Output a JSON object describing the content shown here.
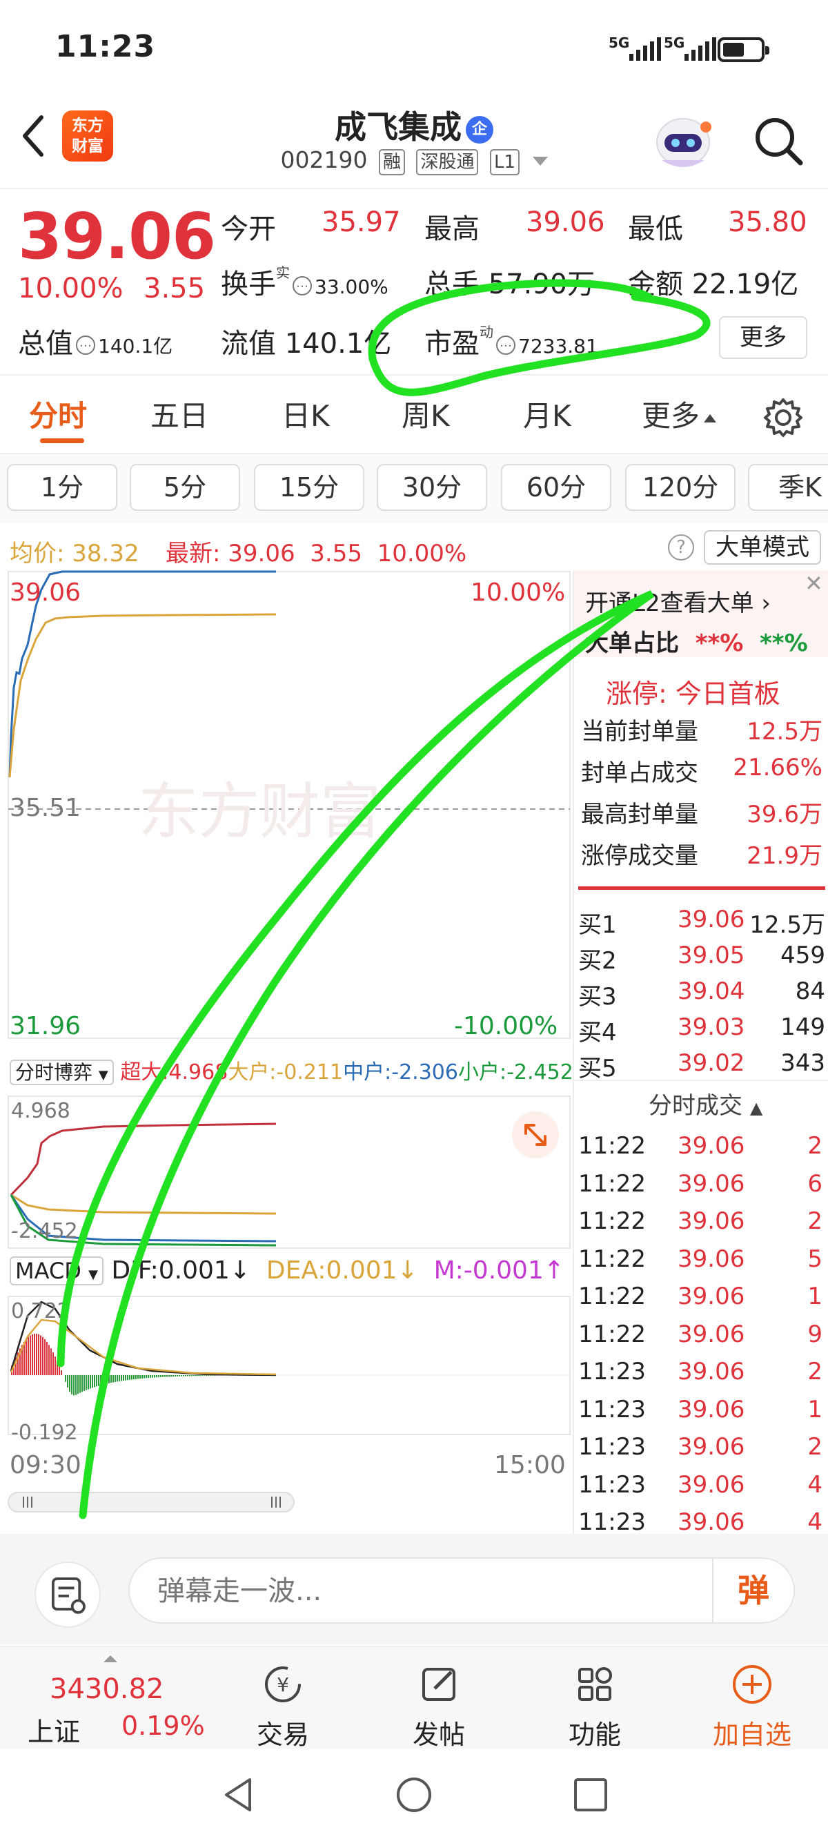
{
  "status_bar": {
    "time": "11:23",
    "signal_1": "5G",
    "signal_2": "5G"
  },
  "header": {
    "logo_line1": "东方",
    "logo_line2": "财富",
    "stock_name": "成飞集成",
    "name_badge": "企",
    "stock_code": "002190",
    "tags": [
      "融",
      "深股通",
      "L1"
    ]
  },
  "quote": {
    "price": "39.06",
    "change_pct": "10.00%",
    "change": "3.55",
    "fields": {
      "open_label": "今开",
      "open": "35.97",
      "high_label": "最高",
      "high": "39.06",
      "low_label": "最低",
      "low": "35.80",
      "turnover_label": "换手",
      "turnover_sup": "实",
      "turnover": "33.00%",
      "volume_label": "总手",
      "volume": "57.90万",
      "amount_label": "金额",
      "amount": "22.19亿",
      "mktcap_label": "总值",
      "mktcap": "140.1亿",
      "float_label": "流值",
      "float": "140.1亿",
      "pe_label": "市盈",
      "pe_sup": "动",
      "pe": "7233.81"
    },
    "more_button": "更多"
  },
  "tabs": [
    "分时",
    "五日",
    "日K",
    "周K",
    "月K",
    "更多"
  ],
  "periods": [
    "1分",
    "5分",
    "15分",
    "30分",
    "60分",
    "120分",
    "季K"
  ],
  "info_line": {
    "avg_label": "均价:",
    "avg": "38.32",
    "latest_label": "最新:",
    "latest": "39.06",
    "latest_change": "3.55",
    "latest_pct": "10.00%",
    "big_order_mode": "大单模式"
  },
  "chart": {
    "price_top": "39.06",
    "price_mid": "35.51",
    "price_bottom": "31.96",
    "pct_top": "10.00%",
    "pct_bottom": "-10.00%",
    "watermark": "东方财富",
    "time_start": "09:30",
    "time_end": "15:00",
    "flow_dropdown": "分时博弈",
    "flow_legend": {
      "super_label": "超大:",
      "super": "4.968",
      "large_label": "大户:",
      "large": "-0.211",
      "mid_label": "中户:",
      "mid": "-2.306",
      "small_label": "小户:",
      "small": "-2.452"
    },
    "flow_top": "4.968",
    "flow_bottom": "-2.452",
    "macd_dropdown": "MACD",
    "macd_legend": {
      "dif": "DIF:0.001",
      "dea": "DEA:0.001",
      "m": "M:-0.001"
    },
    "macd_top": "0.722",
    "macd_bottom": "-0.192"
  },
  "panel": {
    "l2_prompt": "开通L2查看大单",
    "big_order_ratio_label": "大单占比",
    "big_order_ratio_buy": "**%",
    "big_order_ratio_sell": "**%",
    "limit_up_label": "涨停:",
    "limit_up_text": "今日首板",
    "seal_stats": [
      {
        "label": "当前封单量",
        "value": "12.5万"
      },
      {
        "label": "封单占成交",
        "value": "21.66%"
      },
      {
        "label": "最高封单量",
        "value": "39.6万"
      },
      {
        "label": "涨停成交量",
        "value": "21.9万"
      }
    ],
    "bids": [
      {
        "label": "买1",
        "price": "39.06",
        "volume": "12.5万"
      },
      {
        "label": "买2",
        "price": "39.05",
        "volume": "459"
      },
      {
        "label": "买3",
        "price": "39.04",
        "volume": "84"
      },
      {
        "label": "买4",
        "price": "39.03",
        "volume": "149"
      },
      {
        "label": "买5",
        "price": "39.02",
        "volume": "343"
      }
    ],
    "ticks_title": "分时成交",
    "ticks": [
      {
        "time": "11:22",
        "price": "39.06",
        "volume": "2"
      },
      {
        "time": "11:22",
        "price": "39.06",
        "volume": "6"
      },
      {
        "time": "11:22",
        "price": "39.06",
        "volume": "2"
      },
      {
        "time": "11:22",
        "price": "39.06",
        "volume": "5"
      },
      {
        "time": "11:22",
        "price": "39.06",
        "volume": "1"
      },
      {
        "time": "11:22",
        "price": "39.06",
        "volume": "9"
      },
      {
        "time": "11:23",
        "price": "39.06",
        "volume": "2"
      },
      {
        "time": "11:23",
        "price": "39.06",
        "volume": "1"
      },
      {
        "time": "11:23",
        "price": "39.06",
        "volume": "2"
      },
      {
        "time": "11:23",
        "price": "39.06",
        "volume": "4"
      },
      {
        "time": "11:23",
        "price": "39.06",
        "volume": "4"
      }
    ]
  },
  "input_bar": {
    "placeholder": "弹幕走一波...",
    "danmu_button": "弹"
  },
  "bottom_nav": {
    "index_value": "3430.82",
    "index_name": "上证",
    "index_pct": "0.19%",
    "items": [
      "交易",
      "发帖",
      "功能",
      "加自选"
    ]
  },
  "colors": {
    "up": "#e0323b",
    "down": "#1a9a3a",
    "accent": "#e85c1a",
    "avg_line": "#d9a53b",
    "price_line": "#2a6bb5"
  }
}
